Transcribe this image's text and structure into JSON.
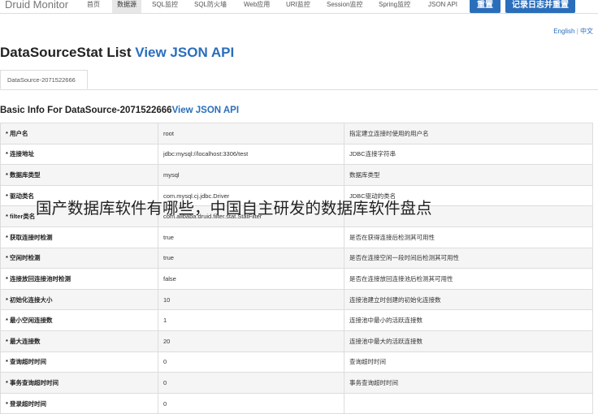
{
  "navbar": {
    "brand": "Druid Monitor",
    "items": [
      "首页",
      "数据源",
      "SQL监控",
      "SQL防火墙",
      "Web应用",
      "URI监控",
      "Session监控",
      "Spring监控",
      "JSON API"
    ],
    "active_index": 1,
    "reset_label": "重置",
    "reset_log_label": "记录日志并重置"
  },
  "lang": {
    "english": "English",
    "separator": "|",
    "chinese": "中文"
  },
  "page": {
    "title": "DataSourceStat List",
    "title_link": "View JSON API"
  },
  "tabs": [
    "DataSource-2071522666"
  ],
  "section": {
    "title": "Basic Info For DataSource-2071522666",
    "title_link": "View JSON API"
  },
  "rows": [
    {
      "key": "* 用户名",
      "value": "root",
      "desc": "指定建立连接时使用的用户名"
    },
    {
      "key": "* 连接地址",
      "value": "jdbc:mysql://localhost:3306/test",
      "desc": "JDBC连接字符串"
    },
    {
      "key": "* 数据库类型",
      "value": "mysql",
      "desc": "数据库类型"
    },
    {
      "key": "* 驱动类名",
      "value": "com.mysql.cj.jdbc.Driver",
      "desc": "JDBC驱动的类名"
    },
    {
      "key": "* filter类名",
      "value": "com.alibaba.druid.filter.stat.StatFilter",
      "desc": ""
    },
    {
      "key": "* 获取连接时检测",
      "value": "true",
      "desc": "是否在获得连接后检测其可用性"
    },
    {
      "key": "* 空闲时检测",
      "value": "true",
      "desc": "是否在连接空闲一段时间后检测其可用性"
    },
    {
      "key": "* 连接放回连接池时检测",
      "value": "false",
      "desc": "是否在连接放回连接池后检测其可用性"
    },
    {
      "key": "* 初始化连接大小",
      "value": "10",
      "desc": "连接池建立时创建的初始化连接数"
    },
    {
      "key": "* 最小空闲连接数",
      "value": "1",
      "desc": "连接池中最小的活跃连接数"
    },
    {
      "key": "* 最大连接数",
      "value": "20",
      "desc": "连接池中最大的活跃连接数"
    },
    {
      "key": "* 查询超时时间",
      "value": "0",
      "desc": "查询超时时间"
    },
    {
      "key": "* 事务查询超时时间",
      "value": "0",
      "desc": "事务查询超时时间"
    },
    {
      "key": "* 登录超时时间",
      "value": "0",
      "desc": ""
    }
  ],
  "overlay_text": "国产数据库软件有哪些，中国自主研发的数据库软件盘点"
}
